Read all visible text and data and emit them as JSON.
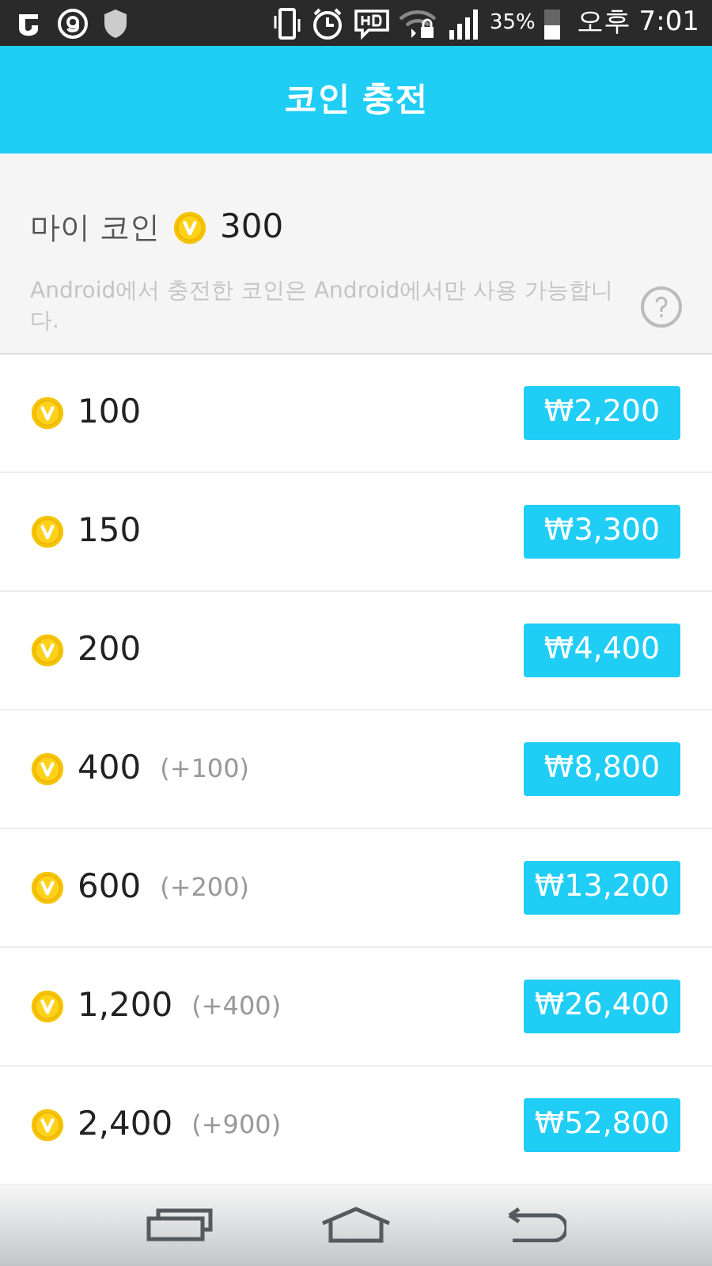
{
  "status_bar": {
    "battery": "35%",
    "time": "오후 7:01"
  },
  "header": {
    "title": "코인 충전"
  },
  "my_coin": {
    "label": "마이 코인",
    "amount": "300",
    "notice": "Android에서 충전한 코인은 Android에서만 사용 가능합니다."
  },
  "packages": [
    {
      "coins": "100",
      "price": "₩2,200"
    },
    {
      "coins": "150",
      "price": "₩3,300"
    },
    {
      "coins": "200",
      "price": "₩4,400"
    },
    {
      "coins": "400",
      "bonus": "(+100)",
      "price": "₩8,800"
    },
    {
      "coins": "600",
      "bonus": "(+200)",
      "price": "₩13,200"
    },
    {
      "coins": "1,200",
      "bonus": "(+400)",
      "price": "₩26,400"
    },
    {
      "coins": "2,400",
      "bonus": "(+900)",
      "price": "₩52,800"
    }
  ]
}
